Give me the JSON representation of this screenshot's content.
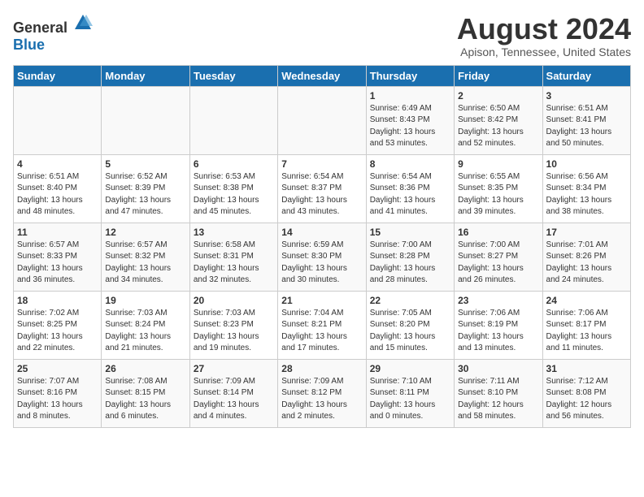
{
  "header": {
    "logo_general": "General",
    "logo_blue": "Blue",
    "title": "August 2024",
    "subtitle": "Apison, Tennessee, United States"
  },
  "weekdays": [
    "Sunday",
    "Monday",
    "Tuesday",
    "Wednesday",
    "Thursday",
    "Friday",
    "Saturday"
  ],
  "weeks": [
    [
      {
        "day": "",
        "info": ""
      },
      {
        "day": "",
        "info": ""
      },
      {
        "day": "",
        "info": ""
      },
      {
        "day": "",
        "info": ""
      },
      {
        "day": "1",
        "info": "Sunrise: 6:49 AM\nSunset: 8:43 PM\nDaylight: 13 hours\nand 53 minutes."
      },
      {
        "day": "2",
        "info": "Sunrise: 6:50 AM\nSunset: 8:42 PM\nDaylight: 13 hours\nand 52 minutes."
      },
      {
        "day": "3",
        "info": "Sunrise: 6:51 AM\nSunset: 8:41 PM\nDaylight: 13 hours\nand 50 minutes."
      }
    ],
    [
      {
        "day": "4",
        "info": "Sunrise: 6:51 AM\nSunset: 8:40 PM\nDaylight: 13 hours\nand 48 minutes."
      },
      {
        "day": "5",
        "info": "Sunrise: 6:52 AM\nSunset: 8:39 PM\nDaylight: 13 hours\nand 47 minutes."
      },
      {
        "day": "6",
        "info": "Sunrise: 6:53 AM\nSunset: 8:38 PM\nDaylight: 13 hours\nand 45 minutes."
      },
      {
        "day": "7",
        "info": "Sunrise: 6:54 AM\nSunset: 8:37 PM\nDaylight: 13 hours\nand 43 minutes."
      },
      {
        "day": "8",
        "info": "Sunrise: 6:54 AM\nSunset: 8:36 PM\nDaylight: 13 hours\nand 41 minutes."
      },
      {
        "day": "9",
        "info": "Sunrise: 6:55 AM\nSunset: 8:35 PM\nDaylight: 13 hours\nand 39 minutes."
      },
      {
        "day": "10",
        "info": "Sunrise: 6:56 AM\nSunset: 8:34 PM\nDaylight: 13 hours\nand 38 minutes."
      }
    ],
    [
      {
        "day": "11",
        "info": "Sunrise: 6:57 AM\nSunset: 8:33 PM\nDaylight: 13 hours\nand 36 minutes."
      },
      {
        "day": "12",
        "info": "Sunrise: 6:57 AM\nSunset: 8:32 PM\nDaylight: 13 hours\nand 34 minutes."
      },
      {
        "day": "13",
        "info": "Sunrise: 6:58 AM\nSunset: 8:31 PM\nDaylight: 13 hours\nand 32 minutes."
      },
      {
        "day": "14",
        "info": "Sunrise: 6:59 AM\nSunset: 8:30 PM\nDaylight: 13 hours\nand 30 minutes."
      },
      {
        "day": "15",
        "info": "Sunrise: 7:00 AM\nSunset: 8:28 PM\nDaylight: 13 hours\nand 28 minutes."
      },
      {
        "day": "16",
        "info": "Sunrise: 7:00 AM\nSunset: 8:27 PM\nDaylight: 13 hours\nand 26 minutes."
      },
      {
        "day": "17",
        "info": "Sunrise: 7:01 AM\nSunset: 8:26 PM\nDaylight: 13 hours\nand 24 minutes."
      }
    ],
    [
      {
        "day": "18",
        "info": "Sunrise: 7:02 AM\nSunset: 8:25 PM\nDaylight: 13 hours\nand 22 minutes."
      },
      {
        "day": "19",
        "info": "Sunrise: 7:03 AM\nSunset: 8:24 PM\nDaylight: 13 hours\nand 21 minutes."
      },
      {
        "day": "20",
        "info": "Sunrise: 7:03 AM\nSunset: 8:23 PM\nDaylight: 13 hours\nand 19 minutes."
      },
      {
        "day": "21",
        "info": "Sunrise: 7:04 AM\nSunset: 8:21 PM\nDaylight: 13 hours\nand 17 minutes."
      },
      {
        "day": "22",
        "info": "Sunrise: 7:05 AM\nSunset: 8:20 PM\nDaylight: 13 hours\nand 15 minutes."
      },
      {
        "day": "23",
        "info": "Sunrise: 7:06 AM\nSunset: 8:19 PM\nDaylight: 13 hours\nand 13 minutes."
      },
      {
        "day": "24",
        "info": "Sunrise: 7:06 AM\nSunset: 8:17 PM\nDaylight: 13 hours\nand 11 minutes."
      }
    ],
    [
      {
        "day": "25",
        "info": "Sunrise: 7:07 AM\nSunset: 8:16 PM\nDaylight: 13 hours\nand 8 minutes."
      },
      {
        "day": "26",
        "info": "Sunrise: 7:08 AM\nSunset: 8:15 PM\nDaylight: 13 hours\nand 6 minutes."
      },
      {
        "day": "27",
        "info": "Sunrise: 7:09 AM\nSunset: 8:14 PM\nDaylight: 13 hours\nand 4 minutes."
      },
      {
        "day": "28",
        "info": "Sunrise: 7:09 AM\nSunset: 8:12 PM\nDaylight: 13 hours\nand 2 minutes."
      },
      {
        "day": "29",
        "info": "Sunrise: 7:10 AM\nSunset: 8:11 PM\nDaylight: 13 hours\nand 0 minutes."
      },
      {
        "day": "30",
        "info": "Sunrise: 7:11 AM\nSunset: 8:10 PM\nDaylight: 12 hours\nand 58 minutes."
      },
      {
        "day": "31",
        "info": "Sunrise: 7:12 AM\nSunset: 8:08 PM\nDaylight: 12 hours\nand 56 minutes."
      }
    ]
  ]
}
